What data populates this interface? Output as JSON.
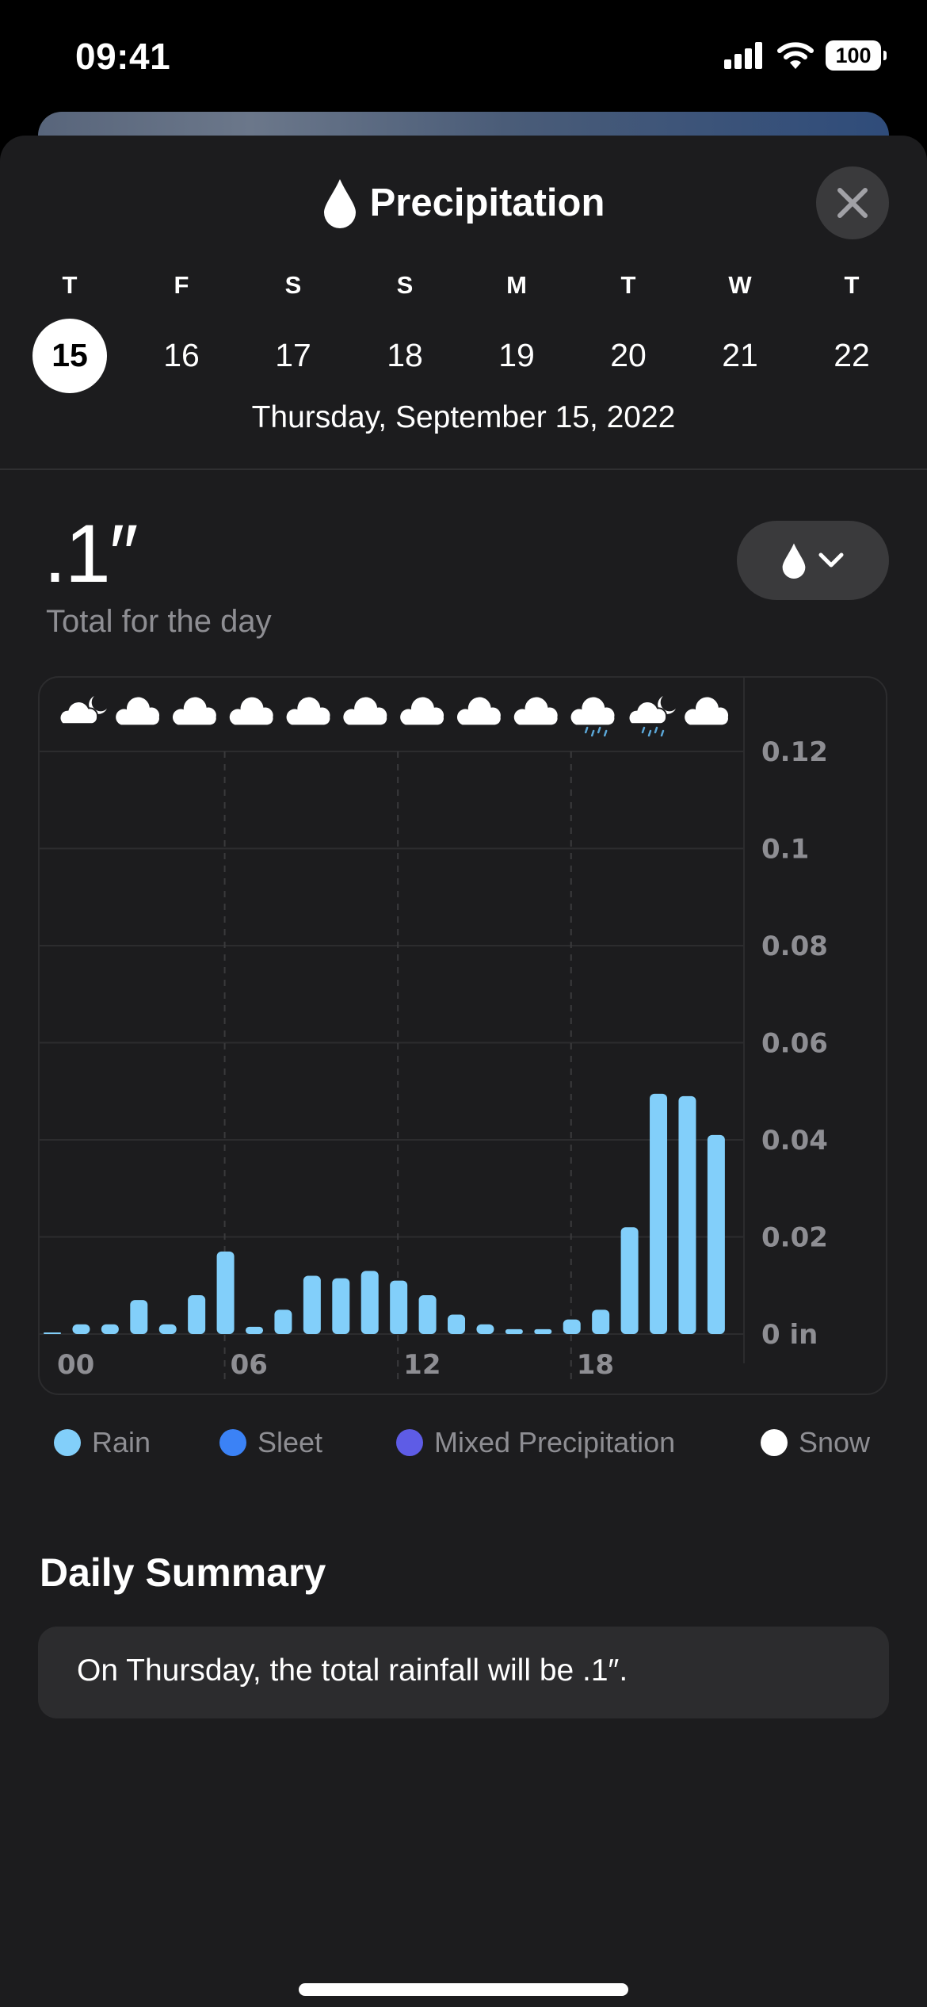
{
  "status_bar": {
    "time": "09:41",
    "battery": "100",
    "icons": [
      "cellular-signal-icon",
      "wifi-icon",
      "battery-icon"
    ]
  },
  "header": {
    "title": "Precipitation",
    "title_icon": "raindrop-icon",
    "close_icon": "close-icon"
  },
  "days": [
    {
      "letter": "T",
      "number": "15",
      "selected": true
    },
    {
      "letter": "F",
      "number": "16",
      "selected": false
    },
    {
      "letter": "S",
      "number": "17",
      "selected": false
    },
    {
      "letter": "S",
      "number": "18",
      "selected": false
    },
    {
      "letter": "M",
      "number": "19",
      "selected": false
    },
    {
      "letter": "T",
      "number": "20",
      "selected": false
    },
    {
      "letter": "W",
      "number": "21",
      "selected": false
    },
    {
      "letter": "T",
      "number": "22",
      "selected": false
    }
  ],
  "selected_date": "Thursday, September 15, 2022",
  "summary_total": {
    "value": ".1″",
    "label": "Total for the day"
  },
  "toggle": {
    "icon": "raindrop-icon",
    "chevron": "chevron-down-icon"
  },
  "condition_icons": [
    "cloud-moon-icon",
    "cloud-icon",
    "cloud-icon",
    "cloud-icon",
    "cloud-icon",
    "cloud-icon",
    "cloud-icon",
    "cloud-icon",
    "cloud-icon",
    "cloud-rain-icon",
    "cloud-moon-rain-icon",
    "cloud-icon"
  ],
  "colors": {
    "rain": "#82cffa",
    "sleet": "#3b82f6",
    "mixed": "#5e5ce6",
    "snow": "#ffffff",
    "background": "#1c1c1e",
    "secondary_text": "#8e8e93"
  },
  "chart_data": {
    "type": "bar",
    "title": "",
    "xlabel": "",
    "ylabel": "in",
    "x": [
      "00",
      "01",
      "02",
      "03",
      "04",
      "05",
      "06",
      "07",
      "08",
      "09",
      "10",
      "11",
      "12",
      "13",
      "14",
      "15",
      "16",
      "17",
      "18",
      "19",
      "20",
      "21",
      "22",
      "23"
    ],
    "series": [
      {
        "name": "Rain",
        "values": [
          0.0003,
          0.002,
          0.002,
          0.007,
          0.002,
          0.008,
          0.017,
          0.0015,
          0.005,
          0.012,
          0.0115,
          0.013,
          0.011,
          0.008,
          0.004,
          0.002,
          0.001,
          0.001,
          0.003,
          0.005,
          0.022,
          0.0495,
          0.049,
          0.041
        ]
      }
    ],
    "x_tick_labels": [
      "00",
      "06",
      "12",
      "18"
    ],
    "x_tick_positions": [
      0,
      6,
      12,
      18
    ],
    "y_tick_labels": [
      "0 in",
      "0.02",
      "0.04",
      "0.06",
      "0.08",
      "0.1",
      "0.12"
    ],
    "y_ticks": [
      0,
      0.02,
      0.04,
      0.06,
      0.08,
      0.1,
      0.12
    ],
    "ylim": [
      0,
      0.12
    ],
    "grid": true,
    "y_axis_side": "right"
  },
  "legend": [
    {
      "label": "Rain",
      "color": "#82cffa"
    },
    {
      "label": "Sleet",
      "color": "#3b82f6"
    },
    {
      "label": "Mixed Precipitation",
      "color": "#5e5ce6"
    },
    {
      "label": "Snow",
      "color": "#ffffff"
    }
  ],
  "daily_summary": {
    "heading": "Daily Summary",
    "text": "On Thursday, the total rainfall will be .1″."
  }
}
